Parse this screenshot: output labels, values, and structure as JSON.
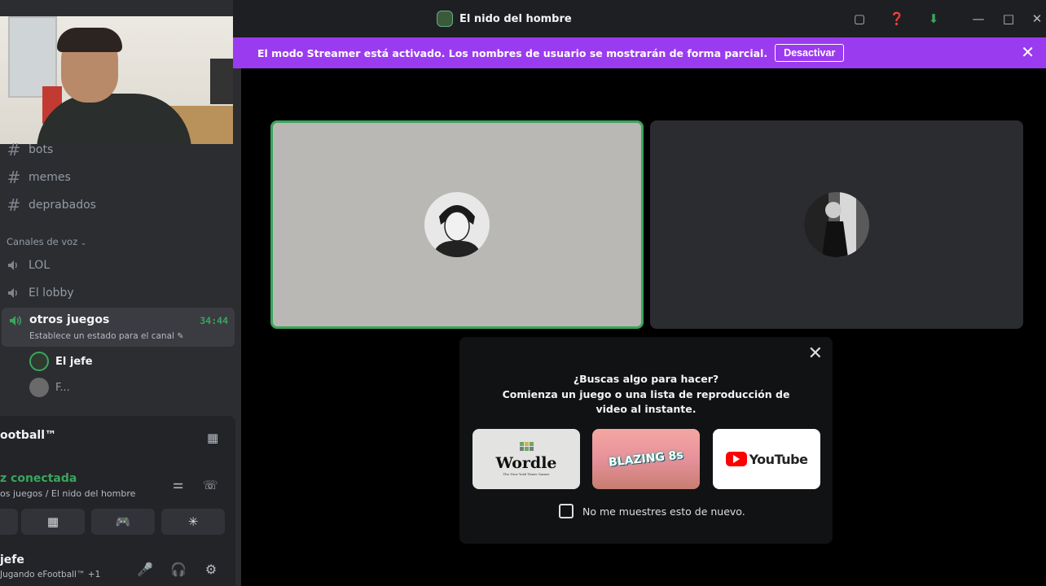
{
  "window": {
    "title": "El nido del hombre"
  },
  "banner": {
    "text": "El modo Streamer está activado. Los nombres de usuario se mostrarán de forma parcial.",
    "button": "Desactivar"
  },
  "sidebar": {
    "text_channels": [
      "bots",
      "memes",
      "deprabados"
    ],
    "voice_category": "Canales de voz",
    "voice_channels": [
      "LOL",
      "El lobby"
    ],
    "active_channel": {
      "name": "otros juegos",
      "timer": "34:44",
      "status_hint": "Establece un estado para el canal"
    },
    "members": [
      "El jefe",
      "F..."
    ]
  },
  "panel": {
    "game": "ootball™",
    "voice_status": "z conectada",
    "voice_location": "os juegos / El nido del hombre",
    "user_name": "jefe",
    "user_status": "Jugando eFootball™ +1"
  },
  "popup": {
    "question": "¿Buscas algo para hacer?",
    "description": "Comienza un juego o una lista de reproducción de video al instante.",
    "activities": [
      {
        "name": "Wordle",
        "subtitle": "The New York Times Games"
      },
      {
        "name": "BLAZING 8s"
      },
      {
        "name": "YouTube"
      }
    ],
    "checkbox_label": "No me muestres esto de nuevo."
  },
  "colors": {
    "accent_purple": "#9b3bf0",
    "speaking_green": "#3ba55c",
    "background": "#000000"
  }
}
